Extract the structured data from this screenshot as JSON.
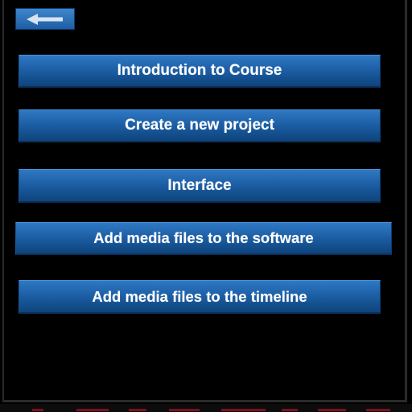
{
  "back_button": {
    "icon": "arrow-left-icon"
  },
  "menu": {
    "items": [
      {
        "label": "Introduction to Course"
      },
      {
        "label": "Create a new project"
      },
      {
        "label": "Interface"
      },
      {
        "label": "Add media files to the software"
      },
      {
        "label": "Add media files to the timeline"
      }
    ]
  },
  "colors": {
    "background": "#000000",
    "button": "#1f62aa",
    "button_text": "#ffffff",
    "bottom_accent": "#7a1020"
  }
}
